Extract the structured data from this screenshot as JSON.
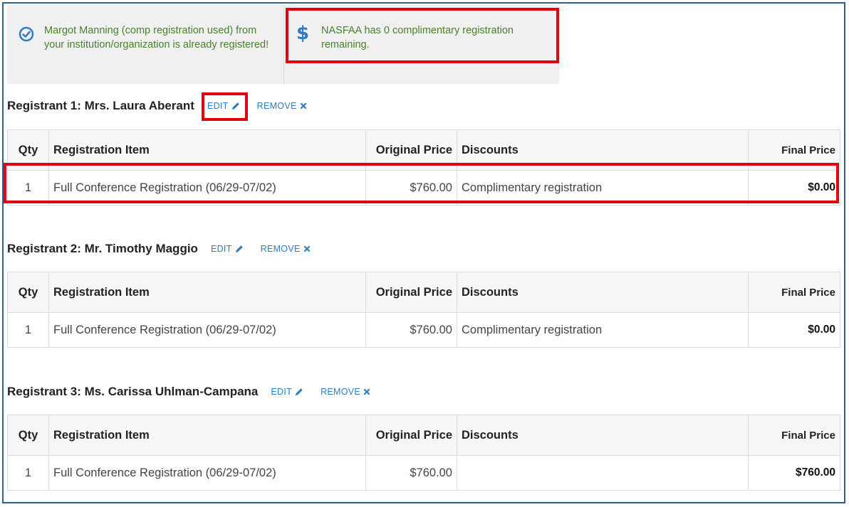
{
  "alerts": {
    "registered_msg": "Margot Manning (comp registration used) from your institution/organization is already registered!",
    "comp_msg": "NASFAA has 0 complimentary registration remaining."
  },
  "actions": {
    "edit": "EDIT",
    "remove": "REMOVE"
  },
  "columns": {
    "qty": "Qty",
    "item": "Registration Item",
    "original": "Original Price",
    "discounts": "Discounts",
    "final": "Final Price"
  },
  "registrants": [
    {
      "title": "Registrant 1: Mrs. Laura Aberant",
      "row": {
        "qty": "1",
        "item": "Full Conference Registration (06/29-07/02)",
        "original": "$760.00",
        "discounts": "Complimentary registration",
        "final": "$0.00"
      }
    },
    {
      "title": "Registrant 2: Mr. Timothy Maggio",
      "row": {
        "qty": "1",
        "item": "Full Conference Registration (06/29-07/02)",
        "original": "$760.00",
        "discounts": "Complimentary registration",
        "final": "$0.00"
      }
    },
    {
      "title": "Registrant 3: Ms. Carissa Uhlman-Campana",
      "row": {
        "qty": "1",
        "item": "Full Conference Registration (06/29-07/02)",
        "original": "$760.00",
        "discounts": "",
        "final": "$760.00"
      }
    }
  ],
  "colors": {
    "alert_text": "#4a7f2f",
    "link": "#2f7bbf",
    "highlight": "#e0000f",
    "frame": "#2f5f8a"
  },
  "icons": {
    "registered": "check-circle-icon",
    "comp": "dollar-icon",
    "edit": "pencil-icon",
    "remove": "x-icon"
  }
}
